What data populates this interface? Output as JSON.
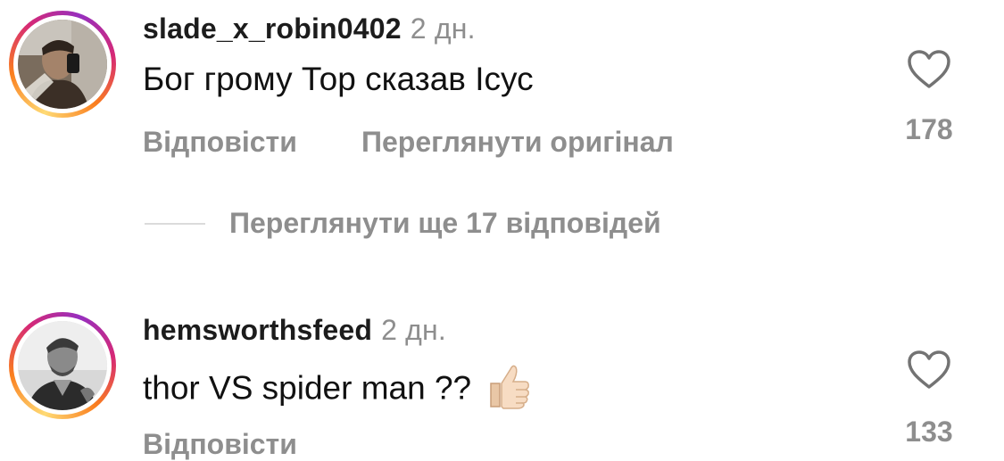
{
  "comments": [
    {
      "username": "slade_x_robin0402",
      "timestamp": "2 дн.",
      "text": "Бог грому Тор сказав Ісус",
      "reply_label": "Відповісти",
      "translate_label": "Переглянути оригінал",
      "likes": "178",
      "avatar_icon": "profile-photo"
    },
    {
      "username": "hemsworthsfeed",
      "timestamp": "2 дн.",
      "text": "thor VS spider man ??",
      "emoji": "thumbs-up",
      "reply_label": "Відповісти",
      "likes": "133",
      "avatar_icon": "profile-photo"
    }
  ],
  "view_replies_label": "Переглянути ще 17 відповідей",
  "colors": {
    "secondary_text": "#8e8e8e",
    "divider": "#dbdbdb",
    "story_ring": [
      "#feda75",
      "#fa7e1e",
      "#d62976",
      "#962fbf"
    ]
  }
}
